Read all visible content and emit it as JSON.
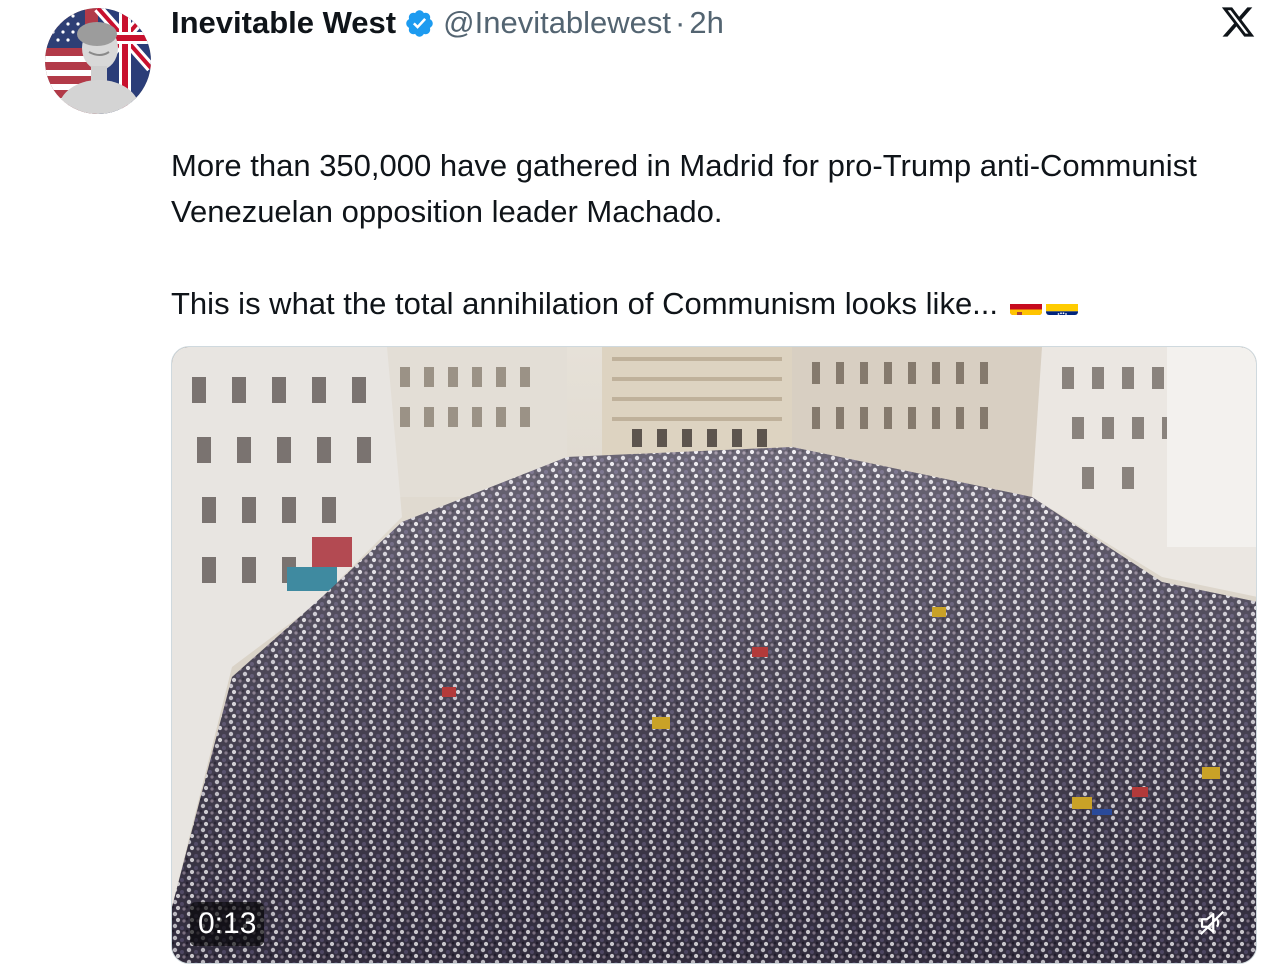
{
  "tweet": {
    "display_name": "Inevitable West",
    "handle": "@Inevitablewest",
    "separator": "·",
    "time": "2h",
    "verified": true,
    "text_line1": "More than 350,000 have gathered in Madrid for pro-Trump anti-Communist Venezuelan opposition leader Machado.",
    "text_line2": "This is what the total annihilation of Communism looks like...",
    "flags": [
      "spain-flag-icon",
      "venezuela-flag-icon"
    ]
  },
  "video": {
    "duration": "0:13",
    "muted": true
  },
  "icons": {
    "verified": "verified-badge-icon",
    "brand": "x-logo-icon",
    "mute": "muted-speaker-icon"
  },
  "colors": {
    "verified_blue": "#1d9bf0",
    "text": "#0f1419",
    "secondary_text": "#536471"
  }
}
